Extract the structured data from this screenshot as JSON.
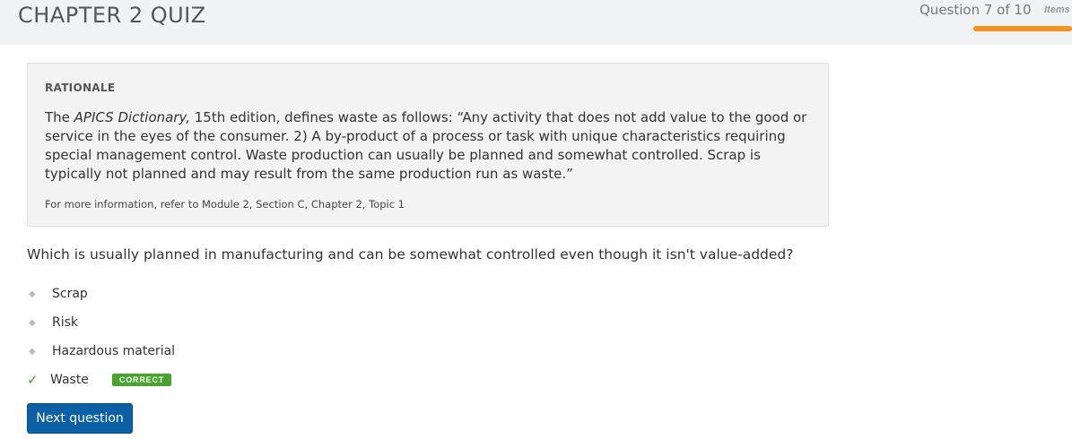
{
  "header": {
    "title": "CHAPTER 2 QUIZ",
    "progress_text": "Question 7 of 10",
    "items_label": "Items",
    "progress_fraction": 0.7
  },
  "rationale": {
    "heading": "RATIONALE",
    "text_prefix": "The ",
    "text_italic": "APICS Dictionary,",
    "text_body": " 15th edition, defines waste as follows: “Any activity that does not add value to the good or service in the eyes of the consumer. 2) A by-product of a process or task with unique characteristics requiring special management control. Waste production can usually be planned and somewhat controlled. Scrap is typically not planned and may result from the same production run as waste.”",
    "reference": "For more information, refer to Module 2, Section C, Chapter 2, Topic 1"
  },
  "question": {
    "text": "Which is usually planned in manufacturing and can be somewhat controlled even though it isn't value-added?",
    "options": [
      {
        "label": "Scrap"
      },
      {
        "label": "Risk"
      },
      {
        "label": "Hazardous material"
      },
      {
        "label": "Waste",
        "badge": "CORRECT"
      }
    ]
  },
  "next_button": {
    "label": "Next question"
  },
  "colors": {
    "accent_orange": "#f7921e",
    "correct_green": "#47a52c",
    "button_blue": "#0b5fa5"
  },
  "icons": {
    "bullet": "diamond-bullet-icon",
    "check": "checkmark-icon"
  }
}
